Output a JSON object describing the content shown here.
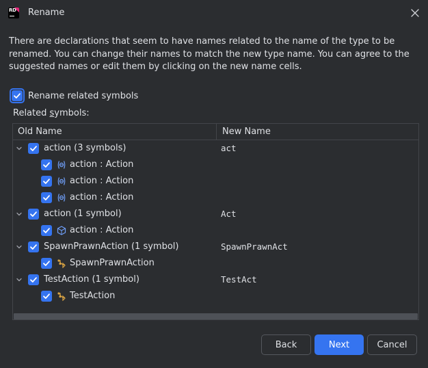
{
  "window": {
    "title": "Rename",
    "app_icon": "rider-logo-icon",
    "app_icon_text": "RD"
  },
  "description": "There are declarations that seem to have names related to the name of the type to be renamed. You can change their names to match the new type name. You can agree to the suggested names or edit them by clicking on the new name cells.",
  "rename_related": {
    "label": "Rename related symbols",
    "checked": true
  },
  "related_label": {
    "prefix": "Related ",
    "mnemonic": "s",
    "suffix": "ymbols:"
  },
  "table": {
    "columns": [
      "Old Name",
      "New Name"
    ],
    "groups": [
      {
        "label": "action (3 symbols)",
        "new_name": "act",
        "checked": true,
        "expanded": true,
        "children": [
          {
            "label": "action : Action",
            "icon": "field-icon",
            "checked": true
          },
          {
            "label": "action : Action",
            "icon": "field-icon",
            "checked": true
          },
          {
            "label": "action : Action",
            "icon": "field-icon",
            "checked": true
          }
        ]
      },
      {
        "label": "action (1 symbol)",
        "new_name": "Act",
        "checked": true,
        "expanded": true,
        "children": [
          {
            "label": "action : Action",
            "icon": "property-icon",
            "checked": true
          }
        ]
      },
      {
        "label": "SpawnPrawnAction (1 symbol)",
        "new_name": "SpawnPrawnAct",
        "checked": true,
        "expanded": true,
        "children": [
          {
            "label": "SpawnPrawnAction",
            "icon": "class-icon",
            "checked": true
          }
        ]
      },
      {
        "label": "TestAction (1 symbol)",
        "new_name": "TestAct",
        "checked": true,
        "expanded": true,
        "children": [
          {
            "label": "TestAction",
            "icon": "class-icon",
            "checked": true
          }
        ]
      }
    ]
  },
  "buttons": {
    "back": "Back",
    "next": "Next",
    "cancel": "Cancel"
  },
  "colors": {
    "background": "#2b2d30",
    "accent": "#3574f0",
    "text": "#dfe1e5",
    "border": "#43454a",
    "logo_accent": "#e4267a",
    "class_icon": "#d9a343",
    "member_icon": "#6f9ef7"
  }
}
